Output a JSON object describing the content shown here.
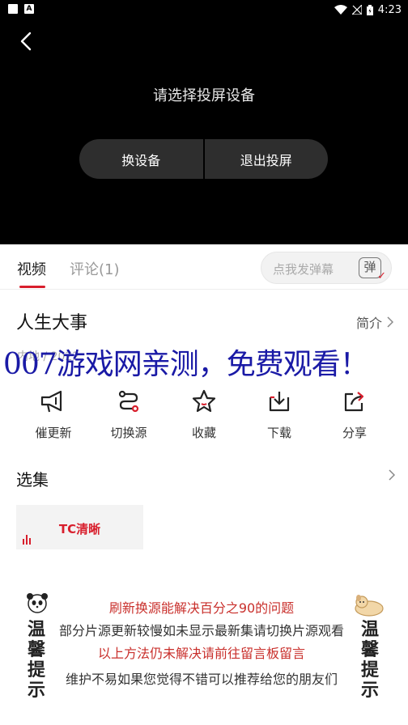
{
  "status_bar": {
    "time": "4:23",
    "left_icon": "A"
  },
  "player": {
    "back_icon": "back-arrow-icon",
    "cast_title": "请选择投屏设备",
    "change_device": "换设备",
    "exit_cast": "退出投屏"
  },
  "tabs": {
    "video": "视频",
    "comment": "评论(1)"
  },
  "danmu": {
    "placeholder": "点我发弹幕",
    "toggle": "弹",
    "check": "✓"
  },
  "show": {
    "title": "人生大事",
    "intro": "简介",
    "meta": "内地 / 2022"
  },
  "promo": "007游戏网亲测，免费观看！",
  "actions": [
    {
      "label": "催更新",
      "icon": "megaphone-icon"
    },
    {
      "label": "切换源",
      "icon": "switch-source-icon"
    },
    {
      "label": "收藏",
      "icon": "star-icon"
    },
    {
      "label": "下载",
      "icon": "download-icon"
    },
    {
      "label": "分享",
      "icon": "share-icon"
    }
  ],
  "episodes": {
    "title": "选集",
    "items": [
      {
        "label": "TC清晰"
      }
    ]
  },
  "notice": {
    "left": "温馨提示",
    "right": "温馨提示",
    "line1": "刷新换源能解决百分之90的问题",
    "line2": "部分片源更新较慢如未显示最新集请切换片源观看",
    "line3": "以上方法仍未解决请前往留言板留言",
    "line4": "维护不易如果您觉得不错可以推荐给您的朋友们"
  },
  "colors": {
    "accent": "#d81e2c",
    "promo": "#1a1aa6"
  }
}
